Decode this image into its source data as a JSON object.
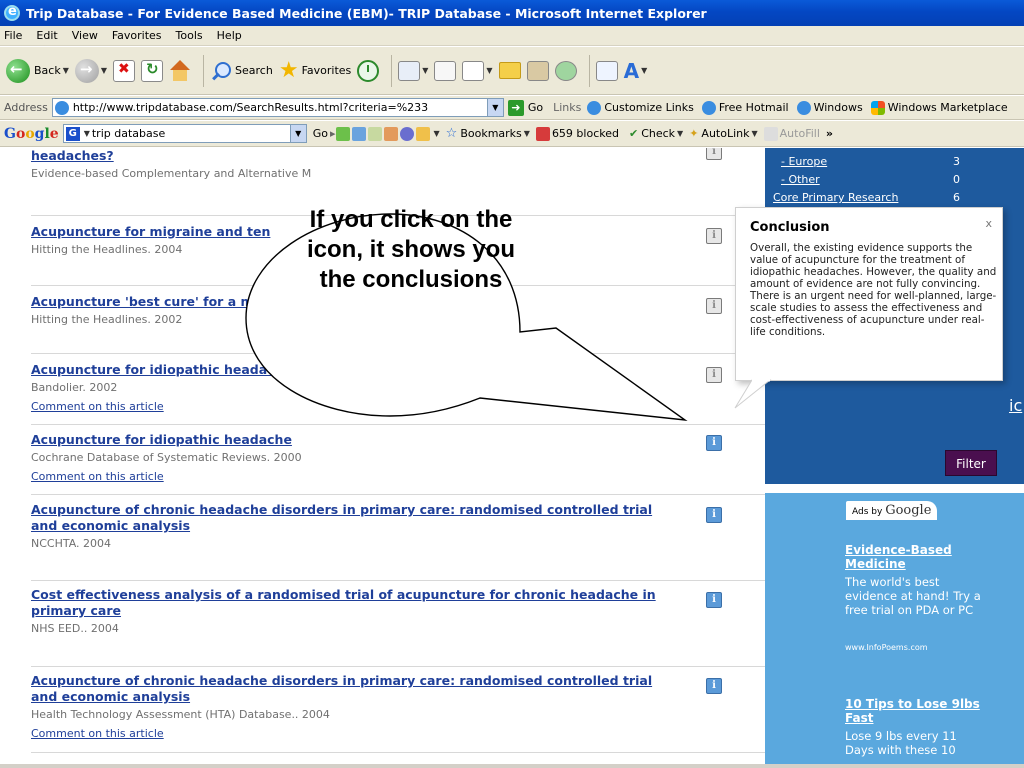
{
  "window": {
    "title": "Trip Database - For Evidence Based Medicine (EBM)- TRIP Database - Microsoft Internet Explorer"
  },
  "menu": [
    "File",
    "Edit",
    "View",
    "Favorites",
    "Tools",
    "Help"
  ],
  "toolbar": {
    "back": "Back",
    "search": "Search",
    "favorites": "Favorites"
  },
  "address": {
    "label": "Address",
    "url": "http://www.tripdatabase.com/SearchResults.html?criteria=%233",
    "go": "Go",
    "links_label": "Links",
    "links": [
      "Customize Links",
      "Free Hotmail",
      "Windows",
      "Windows Marketplace"
    ]
  },
  "google_bar": {
    "logo": "Google",
    "search_value": "trip database",
    "go": "Go",
    "bookmarks": "Bookmarks",
    "blocked": "659 blocked",
    "check": "Check",
    "autolink": "AutoLink",
    "autofill": "AutoFill",
    "more": "»"
  },
  "results": [
    {
      "title": "headaches?",
      "source": "Evidence-based Complementary and Alternative M",
      "comment": ""
    },
    {
      "title": "Acupuncture for migraine and ten",
      "source": "Hitting the Headlines. 2004",
      "comment": ""
    },
    {
      "title": "Acupuncture 'best cure' for a m",
      "source": "Hitting the Headlines. 2002",
      "comment": ""
    },
    {
      "title": "Acupuncture for idiopathic headache",
      "source": "Bandolier. 2002",
      "comment": "Comment on this article"
    },
    {
      "title": "Acupuncture for idiopathic headache",
      "source": "Cochrane Database of Systematic Reviews. 2000",
      "comment": "Comment on this article"
    },
    {
      "title": "Acupuncture of chronic headache disorders in primary care: randomised controlled trial and economic analysis",
      "source": "NCCHTA. 2004",
      "comment": ""
    },
    {
      "title": "Cost effectiveness analysis of a randomised trial of acupuncture for chronic headache in primary care",
      "source": "NHS EED.. 2004",
      "comment": ""
    },
    {
      "title": "Acupuncture of chronic headache disorders in primary care: randomised controlled trial and economic analysis",
      "source": "Health Technology Assessment (HTA) Database.. 2004",
      "comment": "Comment on this article"
    }
  ],
  "sidebar": {
    "items": [
      {
        "label": "- Europe",
        "count": "3"
      },
      {
        "label": "- Other",
        "count": "0"
      },
      {
        "label": "Core Primary Research",
        "count": "6"
      }
    ],
    "partial_link": "ic",
    "filter_button": "Filter"
  },
  "ads": {
    "header_prefix": "Ads by",
    "header_brand": "Google",
    "items": [
      {
        "title": "Evidence-Based Medicine",
        "body": "The world's best evidence at hand! Try a free trial on PDA or PC",
        "url": "www.InfoPoems.com"
      },
      {
        "title": "10 Tips to Lose 9lbs Fast",
        "body": "Lose 9 lbs every 11 Days with these 10",
        "url": ""
      }
    ]
  },
  "popup": {
    "title": "Conclusion",
    "close": "x",
    "body": "Overall, the existing evidence supports the value of acupuncture for the treatment of idiopathic headaches. However, the quality and amount of evidence are not fully convincing. There is an urgent need for well-planned, large-scale studies to assess the effectiveness and cost-effectiveness of acupuncture under real-life conditions."
  },
  "callout": {
    "text": "If you click on the icon, it shows you the conclusions"
  }
}
